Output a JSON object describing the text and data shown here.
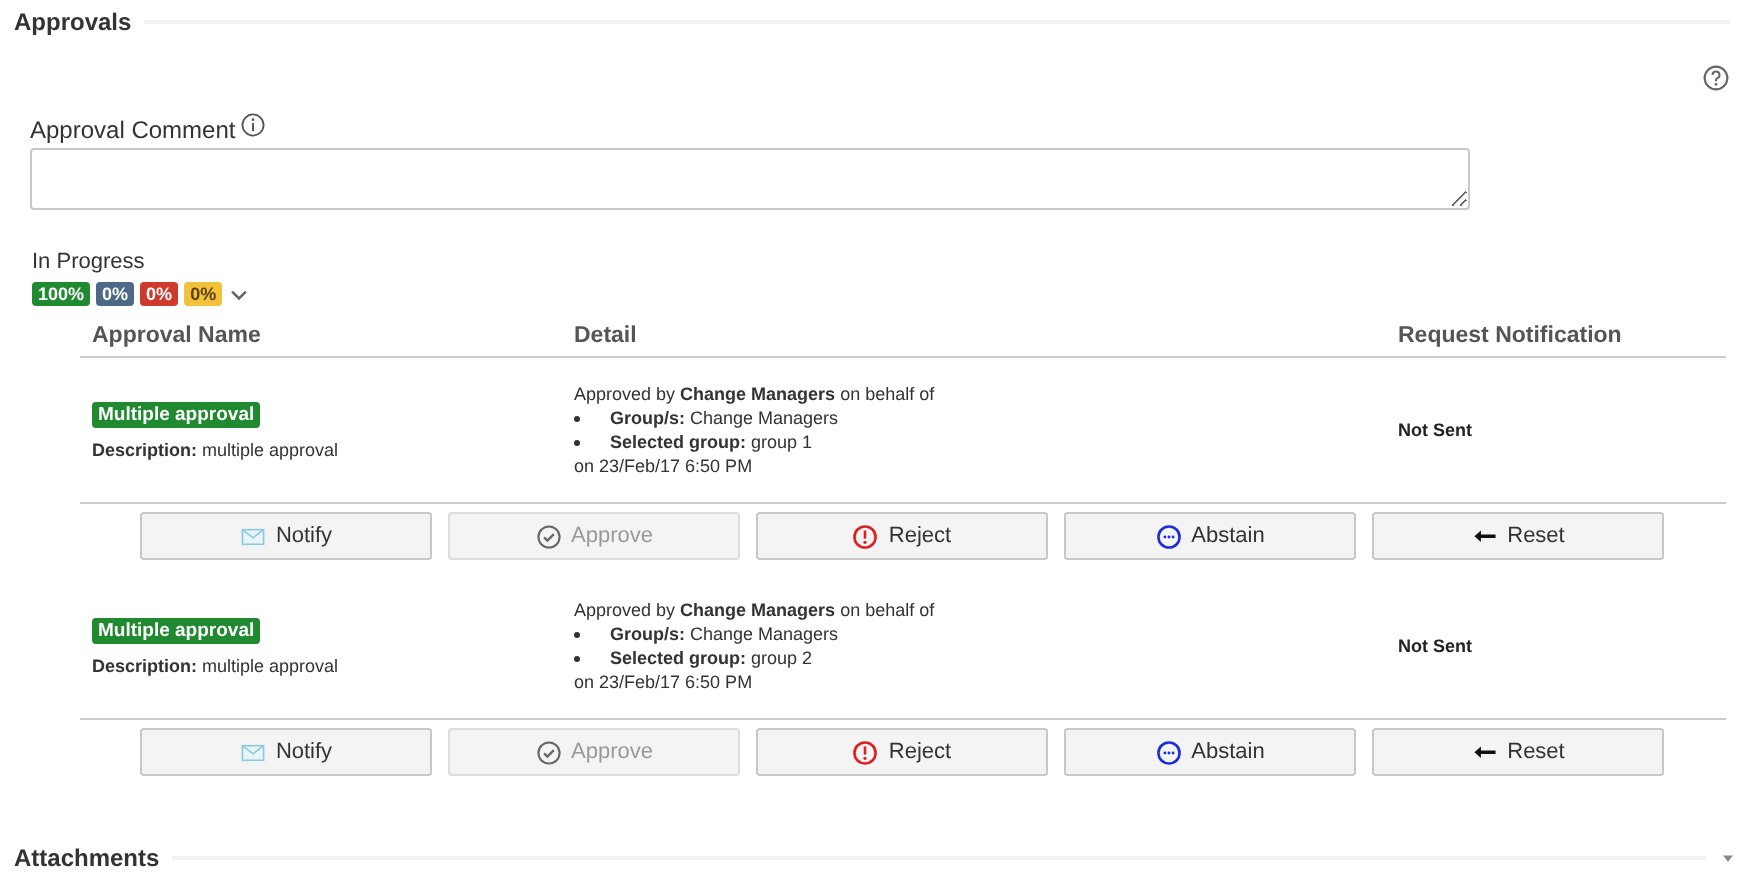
{
  "section": {
    "title": "Approvals"
  },
  "comment": {
    "label": "Approval Comment"
  },
  "progress": {
    "label": "In Progress",
    "badges": [
      {
        "text": "100%",
        "color": "#1f8a30"
      },
      {
        "text": "0%",
        "color": "#4d6987"
      },
      {
        "text": "0%",
        "color": "#cf3a2c"
      },
      {
        "text": "0%",
        "color": "#f2c23c"
      }
    ]
  },
  "table": {
    "columns": [
      "Approval Name",
      "Detail",
      "Request Notification"
    ],
    "rows": [
      {
        "tag": "Multiple approval",
        "description": "**Description:** multiple approval",
        "detail_intro": "Approved by **Change Managers** on behalf of",
        "bullets": [
          "**Group/s:** Change Managers",
          "**Selected group:** group 1"
        ],
        "date": "on 23/Feb/17 6:50 PM",
        "notification": "Not Sent",
        "buttons": [
          {
            "kind": "notify",
            "label": "Notify",
            "disabled": false
          },
          {
            "kind": "approve",
            "label": "Approve",
            "disabled": true
          },
          {
            "kind": "reject",
            "label": "Reject",
            "disabled": false
          },
          {
            "kind": "abstain",
            "label": "Abstain",
            "disabled": false
          },
          {
            "kind": "reset",
            "label": "Reset",
            "disabled": false
          }
        ]
      },
      {
        "tag": "Multiple approval",
        "description": "**Description:** multiple approval",
        "detail_intro": "Approved by **Change Managers** on behalf of",
        "bullets": [
          "**Group/s:** Change Managers",
          "**Selected group:** group 2"
        ],
        "date": "on 23/Feb/17 6:50 PM",
        "notification": "Not Sent",
        "buttons": [
          {
            "kind": "notify",
            "label": "Notify",
            "disabled": false
          },
          {
            "kind": "approve",
            "label": "Approve",
            "disabled": true
          },
          {
            "kind": "reject",
            "label": "Reject",
            "disabled": false
          },
          {
            "kind": "abstain",
            "label": "Abstain",
            "disabled": false
          },
          {
            "kind": "reset",
            "label": "Reset",
            "disabled": false
          }
        ]
      }
    ]
  },
  "next_section": {
    "title": "Attachments"
  }
}
